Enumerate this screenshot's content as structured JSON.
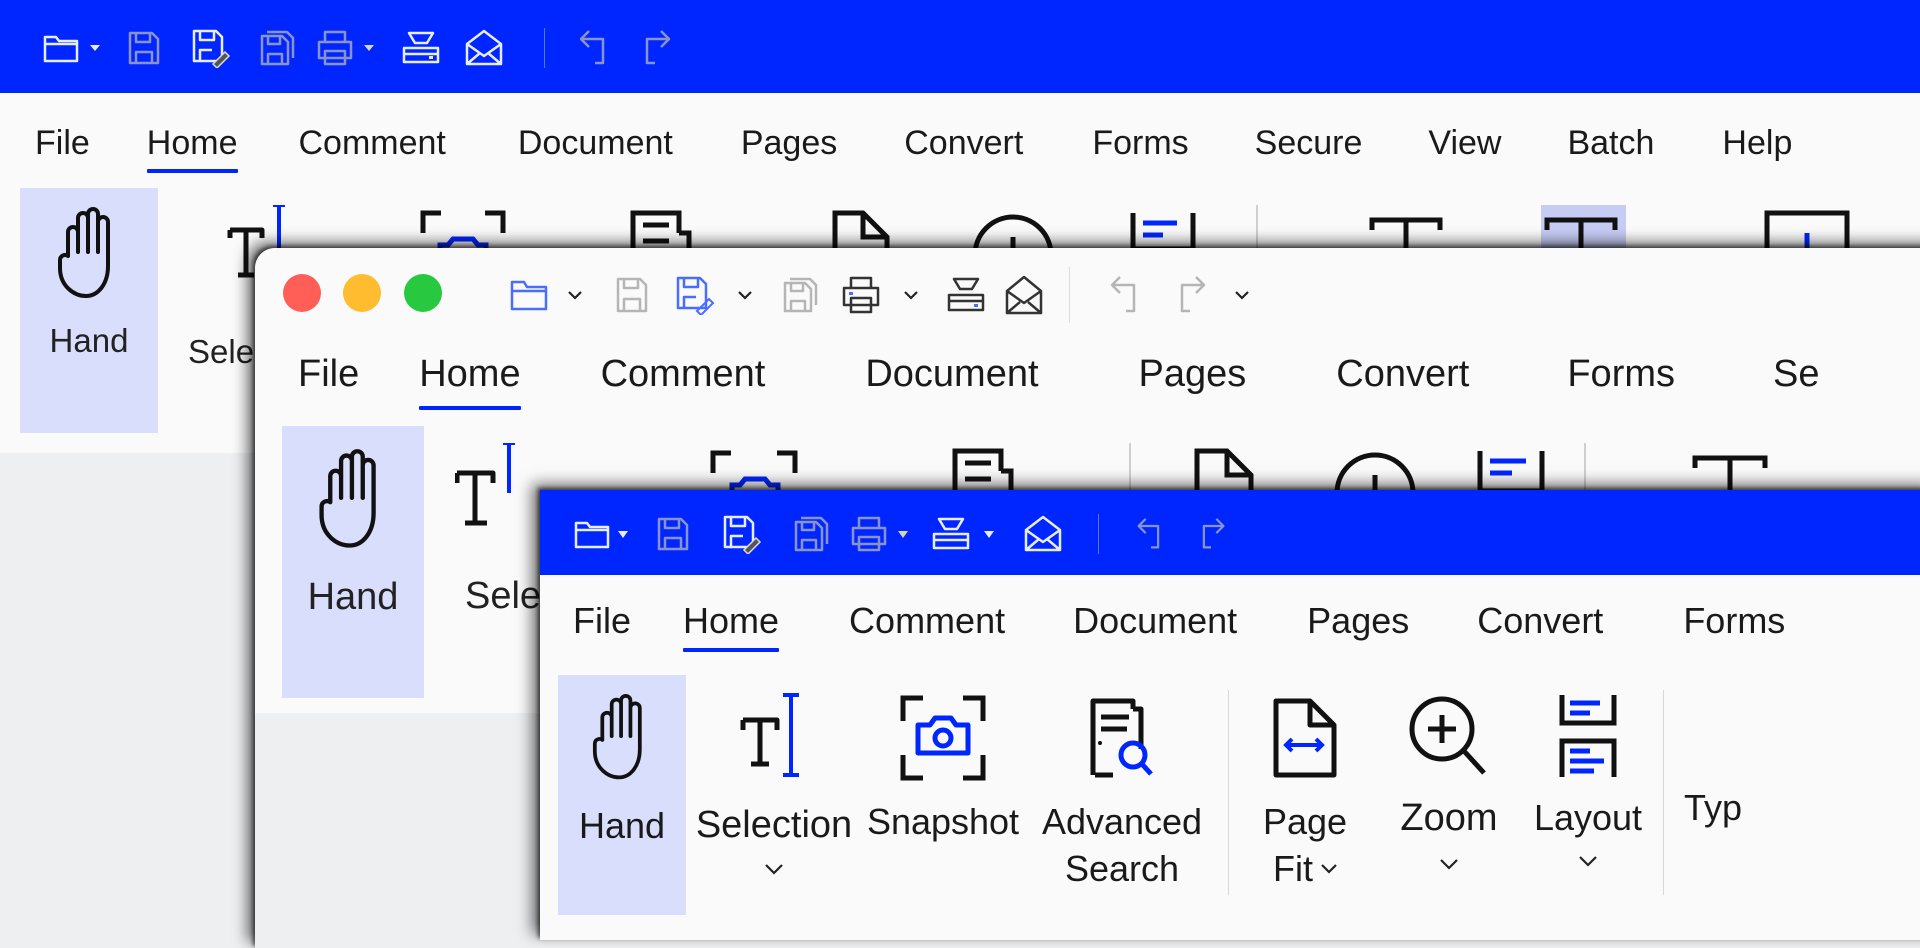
{
  "colors": {
    "brand_blue": "#0026ff",
    "selected_bg": "#d9defd",
    "traffic_red": "#ff5f57",
    "traffic_yellow": "#febc2e",
    "traffic_green": "#28c840"
  },
  "windows": {
    "back": {
      "quick_access": [
        {
          "icon": "open-folder-icon",
          "has_dropdown": true
        },
        {
          "icon": "save-icon",
          "disabled": true
        },
        {
          "icon": "save-as-icon"
        },
        {
          "icon": "save-all-icon",
          "disabled": true
        },
        {
          "icon": "print-icon",
          "has_dropdown": true
        },
        {
          "icon": "scanner-icon"
        },
        {
          "icon": "email-icon"
        },
        {
          "icon": "undo-icon",
          "disabled": true
        },
        {
          "icon": "redo-icon",
          "disabled": true
        }
      ],
      "menu": [
        "File",
        "Home",
        "Comment",
        "Document",
        "Pages",
        "Convert",
        "Forms",
        "Secure",
        "View",
        "Batch",
        "Help"
      ],
      "active_menu": "Home",
      "ribbon": {
        "hand": "Hand",
        "selection_partial": "Sele"
      }
    },
    "middle": {
      "traffic_lights": [
        "close",
        "minimize",
        "maximize"
      ],
      "menu": [
        "File",
        "Home",
        "Comment",
        "Document",
        "Pages",
        "Convert",
        "Forms",
        "Se"
      ],
      "active_menu": "Home",
      "ribbon": {
        "hand": "Hand",
        "selection_partial": "Sele"
      }
    },
    "front": {
      "menu": [
        "File",
        "Home",
        "Comment",
        "Document",
        "Pages",
        "Convert",
        "Forms"
      ],
      "active_menu": "Home",
      "ribbon": [
        {
          "label": "Hand",
          "icon": "hand-icon",
          "selected": true
        },
        {
          "label": "Selection",
          "icon": "text-selection-icon",
          "has_dropdown": true
        },
        {
          "label": "Snapshot",
          "icon": "snapshot-camera-icon"
        },
        {
          "label": "Advanced Search",
          "line1": "Advanced",
          "line2": "Search",
          "icon": "advanced-search-icon"
        },
        {
          "label": "Page Fit",
          "line1": "Page",
          "line2": "Fit",
          "icon": "page-fit-icon",
          "has_dropdown": true
        },
        {
          "label": "Zoom",
          "icon": "zoom-in-icon",
          "has_dropdown": true
        },
        {
          "label": "Layout",
          "icon": "layout-icon",
          "has_dropdown": true
        },
        {
          "label": "Typ",
          "icon": "typewriter-icon"
        }
      ]
    }
  }
}
